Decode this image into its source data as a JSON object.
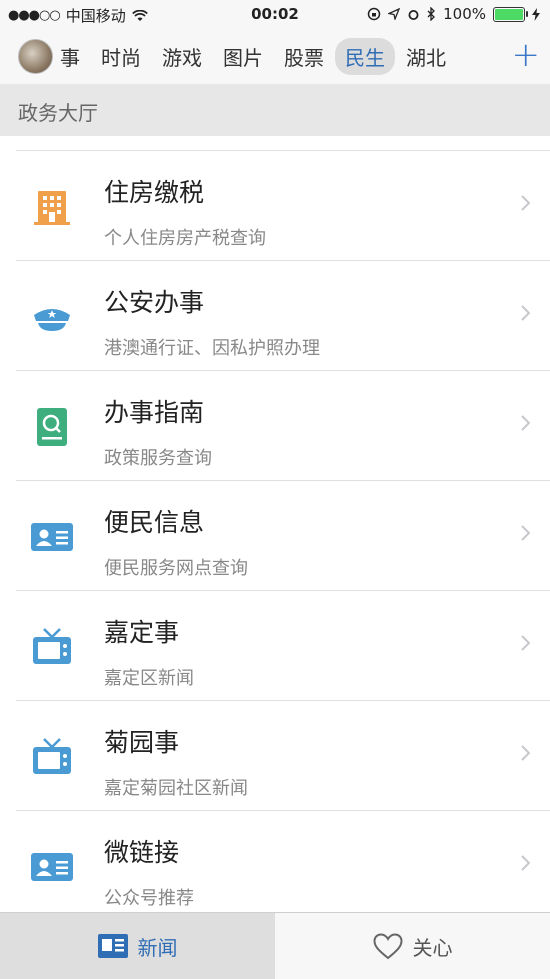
{
  "status_bar": {
    "carrier": "中国移动",
    "time": "00:02",
    "battery": "100%",
    "signal_dots": "●●●○○"
  },
  "channels": {
    "tabs": [
      "事",
      "时尚",
      "游戏",
      "图片",
      "股票",
      "民生",
      "湖北"
    ],
    "active": "民生",
    "add_label": "+"
  },
  "section_title": "政务大厅",
  "services": [
    {
      "title": "住房缴税",
      "subtitle": "个人住房房产税查询",
      "icon": "building-icon",
      "color": "#f0a04b"
    },
    {
      "title": "公安办事",
      "subtitle": "港澳通行证、因私护照办理",
      "icon": "police-cap-icon",
      "color": "#4a9bd4"
    },
    {
      "title": "办事指南",
      "subtitle": "政策服务查询",
      "icon": "search-document-icon",
      "color": "#3fae7f"
    },
    {
      "title": "便民信息",
      "subtitle": "便民服务网点查询",
      "icon": "id-card-icon",
      "color": "#4a9bd4"
    },
    {
      "title": "嘉定事",
      "subtitle": "嘉定区新闻",
      "icon": "tv-icon",
      "color": "#4a9bd4"
    },
    {
      "title": "菊园事",
      "subtitle": "嘉定菊园社区新闻",
      "icon": "tv-icon",
      "color": "#4a9bd4"
    },
    {
      "title": "微链接",
      "subtitle": "公众号推荐",
      "icon": "id-card-icon",
      "color": "#4a9bd4"
    }
  ],
  "tab_bar": {
    "news_label": "新闻",
    "care_label": "关心"
  },
  "colors": {
    "accent": "#2f6db5",
    "background": "#ffffff",
    "section_bg": "#e7e7e7"
  }
}
